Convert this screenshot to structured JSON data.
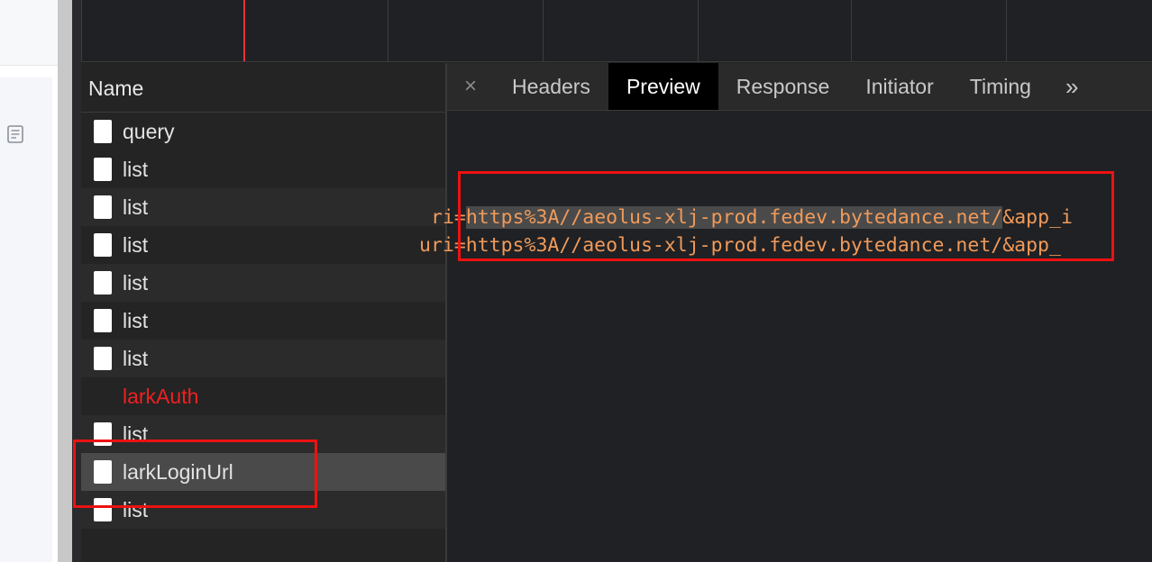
{
  "name_panel": {
    "header": "Name",
    "requests": [
      {
        "label": "query",
        "status": "ok"
      },
      {
        "label": "list",
        "status": "ok"
      },
      {
        "label": "list",
        "status": "ok"
      },
      {
        "label": "list",
        "status": "ok"
      },
      {
        "label": "list",
        "status": "ok"
      },
      {
        "label": "list",
        "status": "ok"
      },
      {
        "label": "list",
        "status": "ok"
      },
      {
        "label": "larkAuth",
        "status": "error"
      },
      {
        "label": "list",
        "status": "ok"
      },
      {
        "label": "larkLoginUrl",
        "status": "selected"
      },
      {
        "label": "list",
        "status": "ok"
      }
    ]
  },
  "detail": {
    "close_glyph": "×",
    "tabs": [
      "Headers",
      "Preview",
      "Response",
      "Initiator",
      "Timing"
    ],
    "active_tab": "Preview",
    "more_glyph": "»",
    "preview": {
      "line1_prefix": "ri=",
      "line1_highlight": "https%3A//aeolus-xlj-prod.fedev.bytedance.net/",
      "line1_suffix": "&app_i",
      "line2_prefix": "uri=",
      "line2_body": "https%3A//aeolus-xlj-prod.fedev.bytedance.net/",
      "line2_suffix": "&app_"
    }
  },
  "colors": {
    "annotation": "#ee1111",
    "error_text": "#ee2020",
    "code_text": "#f09a5a"
  }
}
